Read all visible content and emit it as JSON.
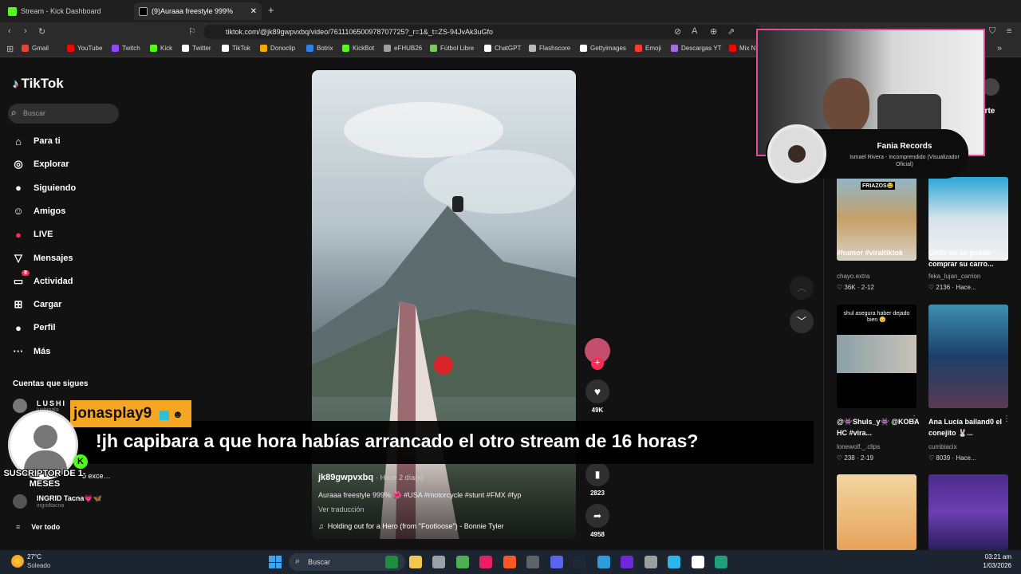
{
  "browser": {
    "tabs": [
      {
        "label": "Stream - Kick Dashboard",
        "color": "#53fc18"
      },
      {
        "label": "(9)Auraaa freestyle 999%",
        "color": "#ffffff"
      }
    ],
    "url": "tiktok.com/@jk89gwpvxbq/video/7611106500978707725?_r=1&_t=ZS-94JvAk3uGfo",
    "bookmarks": [
      "Gmail",
      "YouTube",
      "Twitch",
      "Kick",
      "Twitter",
      "TikTok",
      "Donoclip",
      "Botrix",
      "KickBot",
      "eFHUB26",
      "Fútbol Libre",
      "ChatGPT",
      "Flashscore",
      "Gettyimages",
      "Emoji",
      "Descargas YT",
      "Mix N"
    ]
  },
  "tiktok": {
    "logo": "TikTok",
    "search_placeholder": "Buscar",
    "nav": [
      {
        "label": "Para ti",
        "icon": "home-icon",
        "glyph": "⌂"
      },
      {
        "label": "Explorar",
        "icon": "compass-icon",
        "glyph": "◎"
      },
      {
        "label": "Siguiendo",
        "icon": "following-icon",
        "glyph": "●"
      },
      {
        "label": "Amigos",
        "icon": "friends-icon",
        "glyph": "☺"
      },
      {
        "label": "LIVE",
        "icon": "live-icon",
        "glyph": "●"
      },
      {
        "label": "Mensajes",
        "icon": "messages-icon",
        "glyph": "▽"
      },
      {
        "label": "Actividad",
        "icon": "activity-icon",
        "glyph": "▭"
      },
      {
        "label": "Cargar",
        "icon": "upload-icon",
        "glyph": "⊞"
      },
      {
        "label": "Perfil",
        "icon": "profile-icon",
        "glyph": "●"
      },
      {
        "label": "Más",
        "icon": "more-icon",
        "glyph": "···"
      }
    ],
    "activity_badge": "9",
    "following_heading": "Cuentas que sigues",
    "following": [
      {
        "name": "LUSHI",
        "handle": "lushipala"
      },
      {
        "name": "o exce…",
        "handle": ""
      },
      {
        "name": "INGRID Tacna💗🦋",
        "handle": "ingridtacna"
      }
    ],
    "see_all": "Ver todo",
    "video": {
      "author": "jk89gwpvxbq",
      "time": "· Hace 2 día(s)",
      "caption": "Auraaa freestyle 999% 🌺 #USA #motorcycle #stunt #FMX #fyp",
      "translate": "Ver traducción",
      "music": "Holding out for a Hero (from \"Footloose\") - Bonnie Tyler",
      "likes": "49K",
      "saves": "2823",
      "shares": "4958"
    },
    "right_cards": [
      {
        "overlay": "FRIAZOS😂",
        "title": "#humor #viraltiktok",
        "user": "chayo.extra",
        "likes": "36K",
        "date": "2-12"
      },
      {
        "overlay": "",
        "title": "Cirilo no se puede comprar su carro...",
        "user": "feka_lujan_carrion",
        "likes": "2136",
        "date": "Hace..."
      },
      {
        "overlay": "shul asegura haber dejado bien 😌",
        "title": "@👾Shuls_y👾 @KOBA HC #vira...",
        "user": "lonewolf._.clips",
        "likes": "238",
        "date": "2-19"
      },
      {
        "overlay": "",
        "title": "Ana Lucía bailand0 el conejito 🐰...",
        "user": "cumbiacix",
        "likes": "8039",
        "date": "Hace..."
      }
    ],
    "share_label": "arte"
  },
  "stream_overlay": {
    "chat_user": "jonasplay9",
    "chat_message": "!jh capibara a que hora habías arrancado el otro stream de 16 horas?",
    "sub_label": "SUSCRIPTOR DE 1-MESES",
    "now_playing_artist": "Fania Records",
    "now_playing_track": "Ismael Rivera - Incomprendido (Visualizador Oficial)"
  },
  "taskbar": {
    "temp": "27°C",
    "weather": "Soleado",
    "search": "Buscar",
    "time": "03:21 am",
    "date": "1/03/2026"
  },
  "colors": {
    "accent": "#fe2c55",
    "kick": "#53fc18",
    "chat_name_bg": "#f5a623"
  }
}
